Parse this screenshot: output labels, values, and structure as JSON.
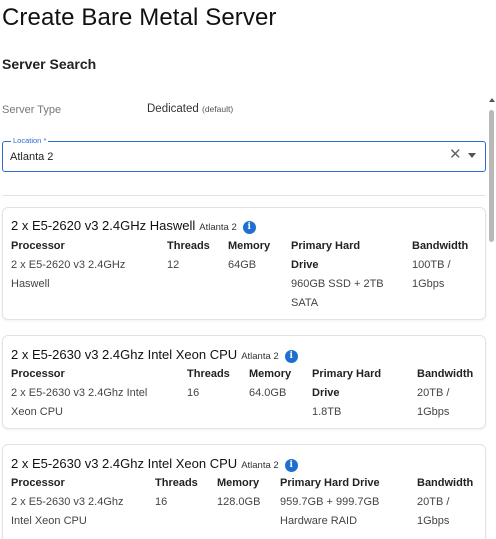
{
  "header": {
    "title": "Create Bare Metal Server"
  },
  "search": {
    "title": "Server Search",
    "server_type_label": "Server Type",
    "server_type_value": "Dedicated",
    "server_type_note": "(default)",
    "location_label": "Location *",
    "location_value": "Atlanta 2"
  },
  "results": [
    {
      "title": "2 x E5-2620 v3 2.4GHz Haswell",
      "location": "Atlanta 2",
      "headers": {
        "processor": "Processor",
        "threads": "Threads",
        "memory": "Memory",
        "drive_1": "Primary Hard",
        "drive_2": "Drive",
        "bandwidth": "Bandwidth"
      },
      "processor": [
        "2 x E5-2620 v3 2.4GHz",
        "Haswell"
      ],
      "threads": "12",
      "memory": "64GB",
      "drive": [
        "960GB SSD + 2TB",
        "SATA"
      ],
      "bandwidth": [
        "100TB /",
        "1Gbps"
      ]
    },
    {
      "title": "2 x E5-2630 v3 2.4Ghz Intel Xeon CPU",
      "location": "Atlanta 2",
      "headers": {
        "processor": "Processor",
        "threads": "Threads",
        "memory": "Memory",
        "drive_1": "Primary Hard",
        "drive_2": "Drive",
        "bandwidth": "Bandwidth"
      },
      "processor": [
        "2 x E5-2630 v3 2.4Ghz Intel",
        "Xeon CPU"
      ],
      "threads": "16",
      "memory": "64.0GB",
      "drive": [
        "1.8TB"
      ],
      "bandwidth": [
        "20TB /",
        "1Gbps"
      ]
    },
    {
      "title": "2 x E5-2630 v3 2.4Ghz Intel Xeon CPU",
      "location": "Atlanta 2",
      "headers": {
        "processor": "Processor",
        "threads": "Threads",
        "memory": "Memory",
        "drive_1": "Primary Hard Drive",
        "bandwidth": "Bandwidth"
      },
      "processor": [
        "2 x E5-2630 v3 2.4Ghz",
        "Intel Xeon CPU"
      ],
      "threads": "16",
      "memory": "128.0GB",
      "drive": [
        "959.7GB + 999.7GB",
        "Hardware RAID"
      ],
      "bandwidth": [
        "20TB /",
        "1Gbps"
      ]
    }
  ],
  "theme": {
    "accent": "#2c6ccf",
    "info_icon": "#1f6fd1"
  }
}
